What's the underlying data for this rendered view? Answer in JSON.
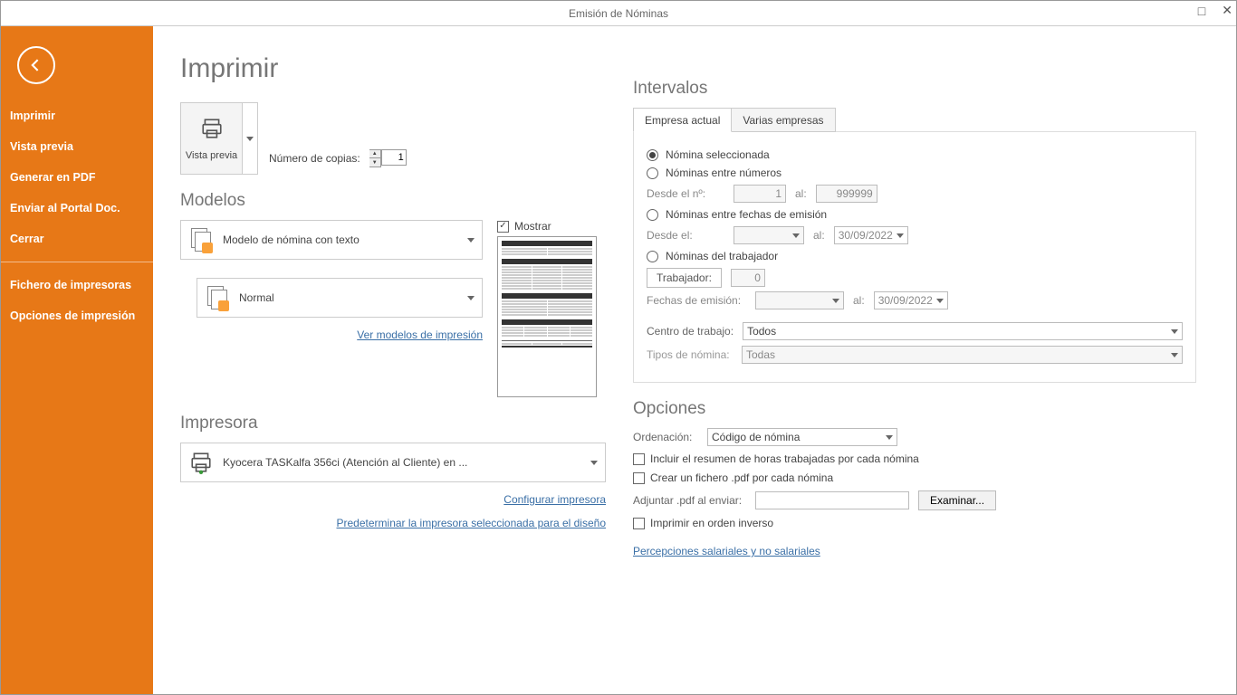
{
  "window_title": "Emisión de Nóminas",
  "sidebar": {
    "items": [
      "Imprimir",
      "Vista previa",
      "Generar en PDF",
      "Enviar al Portal Doc.",
      "Cerrar"
    ],
    "items2": [
      "Fichero de impresoras",
      "Opciones de impresión"
    ]
  },
  "page_title": "Imprimir",
  "vista_previa_label": "Vista previa",
  "num_copias_label": "Número de copias:",
  "num_copias_value": "1",
  "sec_modelos": "Modelos",
  "mostrar_label": "Mostrar",
  "modelo1": "Modelo de nómina con texto",
  "modelo2": "Normal",
  "ver_modelos": "Ver modelos de impresión",
  "sec_impresora": "Impresora",
  "printer_name": "Kyocera TASKalfa 356ci (Atención al Cliente) en ...",
  "config_impresora": "Configurar impresora",
  "predeterminar": "Predeterminar la impresora seleccionada para el diseño",
  "sec_intervalos": "Intervalos",
  "tab_empresa": "Empresa actual",
  "tab_varias": "Varias empresas",
  "r_sel": "Nómina seleccionada",
  "r_entre_num": "Nóminas entre números",
  "desde_n": "Desde el nº:",
  "desde_n_val": "1",
  "al": "al:",
  "hasta_n_val": "999999",
  "r_fechas": "Nóminas entre fechas de emisión",
  "desde_el": "Desde el:",
  "fecha2": "30/09/2022",
  "r_trab": "Nóminas del trabajador",
  "trabajador_lbl": "Trabajador:",
  "trabajador_val": "0",
  "fechas_emision": "Fechas de emisión:",
  "fecha4": "30/09/2022",
  "centro_lbl": "Centro de trabajo:",
  "centro_val": "Todos",
  "tipos_lbl": "Tipos de nómina:",
  "tipos_val": "Todas",
  "sec_opciones": "Opciones",
  "orden_lbl": "Ordenación:",
  "orden_val": "Código de nómina",
  "chk_resumen": "Incluir el resumen de horas trabajadas por cada nómina",
  "chk_pdf": "Crear un fichero .pdf por cada nómina",
  "adjuntar_lbl": "Adjuntar .pdf al enviar:",
  "examinar": "Examinar...",
  "chk_inverso": "Imprimir en orden inverso",
  "percepciones": "Percepciones salariales y no salariales"
}
